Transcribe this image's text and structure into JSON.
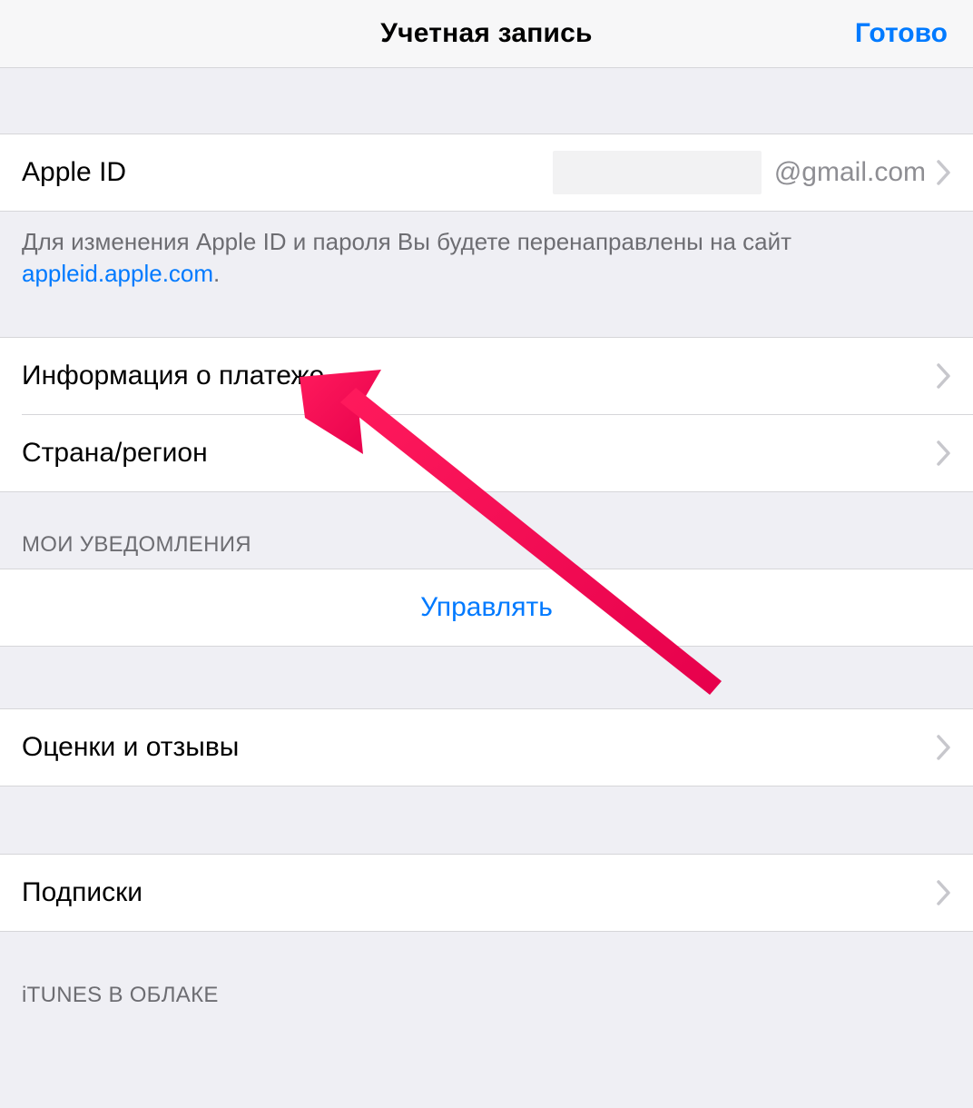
{
  "nav": {
    "title": "Учетная запись",
    "done": "Готово"
  },
  "apple_id_row": {
    "label": "Apple ID",
    "value_suffix": "@gmail.com"
  },
  "apple_id_note": {
    "text_prefix": "Для изменения Apple ID и пароля Вы будете перенаправлены на сайт ",
    "link_text": "appleid.apple.com",
    "period": "."
  },
  "rows": {
    "payment_info": "Информация о платеже",
    "country_region": "Страна/регион",
    "manage": "Управлять",
    "ratings_reviews": "Оценки и отзывы",
    "subscriptions": "Подписки"
  },
  "section_headers": {
    "my_notifications": "МОИ УВЕДОМЛЕНИЯ",
    "itunes_cloud": "iTUNES В ОБЛАКЕ"
  }
}
